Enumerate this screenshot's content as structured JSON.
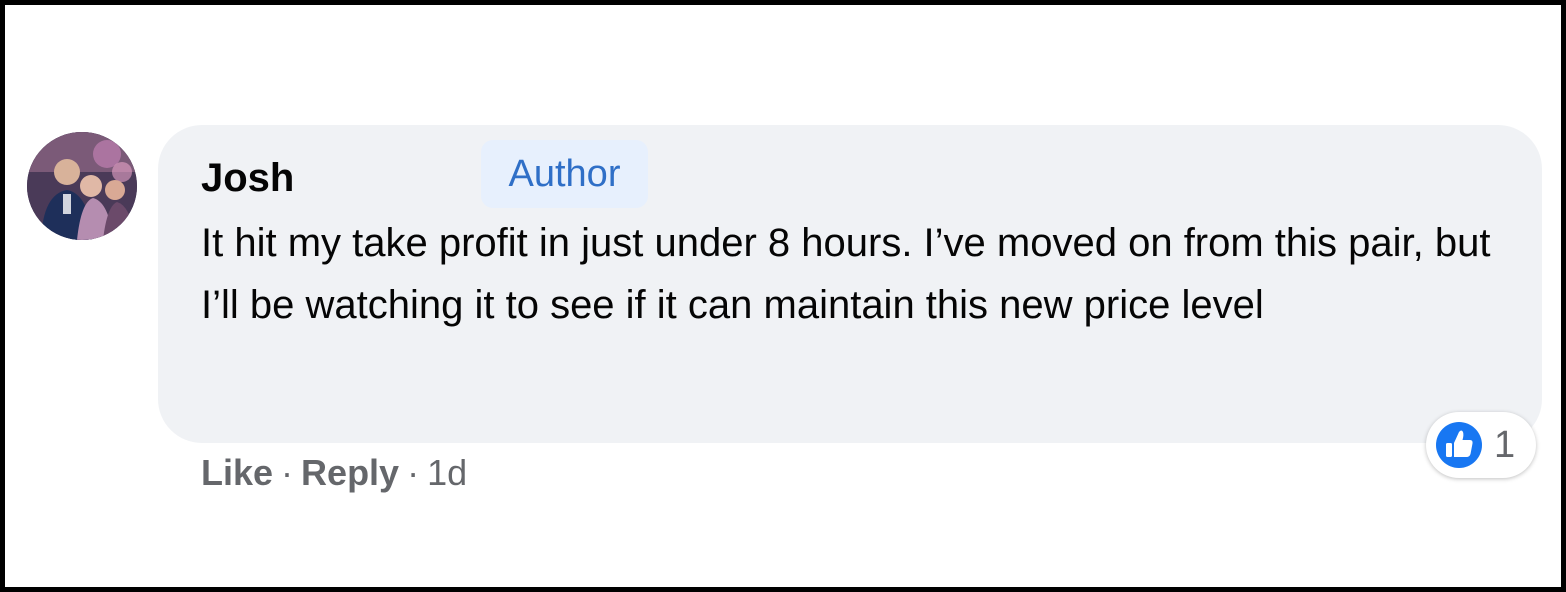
{
  "comment": {
    "author": "Josh",
    "badge": "Author",
    "text": "It hit my take profit in just under 8 hours. I’ve moved on from this pair, but I’ll be watching it to see if it can maintain this new price level",
    "avatar_icon": "profile-photo",
    "actions": {
      "like_label": "Like",
      "separator": "·",
      "reply_label": "Reply",
      "timestamp": "1d"
    },
    "reactions": {
      "icon": "like-thumbs-up-icon",
      "count": "1"
    }
  },
  "colors": {
    "bubble": "#f0f2f5",
    "badge_bg": "#e7f0fd",
    "badge_text": "#2f6fc7",
    "like_blue": "#1877f2",
    "muted_text": "#65676b",
    "frame_border": "#000000"
  }
}
